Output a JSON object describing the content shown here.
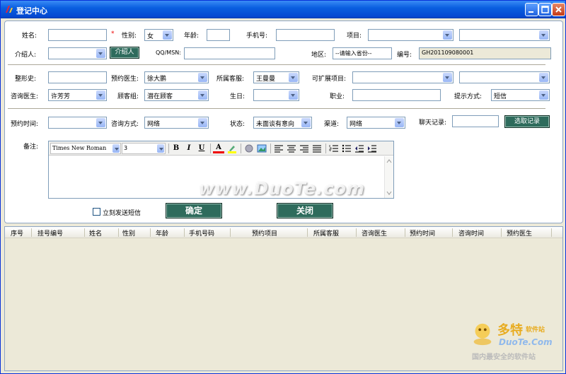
{
  "window": {
    "title": "登记中心"
  },
  "form": {
    "name_label": "姓名:",
    "required_mark": "*",
    "gender_label": "性别:",
    "gender_value": "女",
    "age_label": "年龄:",
    "phone_label": "手机号:",
    "project_label": "项目:",
    "introducer_label": "介绍人:",
    "introducer_button": "介绍人",
    "qq_label": "QQ/MSN:",
    "region_label": "地区:",
    "region_placeholder": "--请输入省份--",
    "number_label": "编号:",
    "number_value": "GH201109080001",
    "history_label": "整形史:",
    "booking_doctor_label": "预约医生:",
    "booking_doctor_value": "徐大鹏",
    "service_label": "所属客服:",
    "service_value": "王曼曼",
    "expand_project_label": "可扩展项目:",
    "consult_doctor_label": "咨询医生:",
    "consult_doctor_value": "许芳芳",
    "customer_group_label": "顾客组:",
    "customer_group_value": "潜在顾客",
    "birthday_label": "生日:",
    "job_label": "职业:",
    "notify_label": "提示方式:",
    "notify_value": "短信",
    "booking_time_label": "预约时间:",
    "consult_way_label": "咨询方式:",
    "consult_way_value": "网络",
    "status_label": "状态:",
    "status_value": "未面谈有意向",
    "channel_label": "渠道:",
    "channel_value": "网络",
    "chat_label": "聊天记录:",
    "chat_button": "选取记录",
    "remark_label": "备注:",
    "font_name": "Times New Roman",
    "font_size": "3",
    "sms_checkbox_label": "立刻发送短信",
    "ok_button": "确定",
    "close_button": "关闭"
  },
  "table": {
    "columns": [
      "序号",
      "挂号编号",
      "姓名",
      "性别",
      "年龄",
      "手机号码",
      "预约项目",
      "所属客服",
      "咨询医生",
      "预约时间",
      "咨询时间",
      "预约医生"
    ]
  },
  "watermark": {
    "text": "www.DuoTe.com"
  },
  "logo": {
    "line1": "多特",
    "line1b": "软件站",
    "line2": "DuoTe.Com",
    "line3": "国内最安全的软件站"
  },
  "colors": {
    "accent": "#2e6b5c",
    "titlebar": "#0a5fe0"
  }
}
